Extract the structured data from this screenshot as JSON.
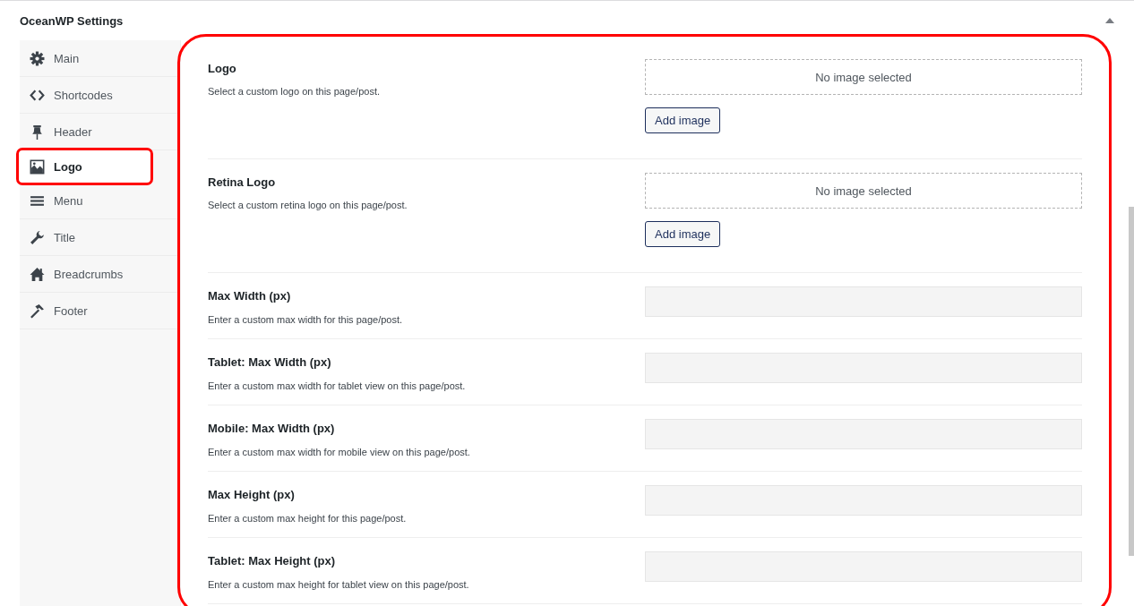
{
  "panel": {
    "title": "OceanWP Settings",
    "expanded": true
  },
  "sidebar": {
    "items": [
      {
        "label": "Main",
        "selected": false
      },
      {
        "label": "Shortcodes",
        "selected": false
      },
      {
        "label": "Header",
        "selected": false
      },
      {
        "label": "Logo",
        "selected": true
      },
      {
        "label": "Menu",
        "selected": false
      },
      {
        "label": "Title",
        "selected": false
      },
      {
        "label": "Breadcrumbs",
        "selected": false
      },
      {
        "label": "Footer",
        "selected": false
      }
    ]
  },
  "settings": [
    {
      "kind": "image",
      "label": "Logo",
      "description": "Select a custom logo on this page/post.",
      "preview": "No image selected",
      "button": "Add image"
    },
    {
      "kind": "image",
      "label": "Retina Logo",
      "description": "Select a custom retina logo on this page/post.",
      "preview": "No image selected",
      "button": "Add image"
    },
    {
      "kind": "number",
      "label": "Max Width (px)",
      "description": "Enter a custom max width for this page/post."
    },
    {
      "kind": "number",
      "label": "Tablet: Max Width (px)",
      "description": "Enter a custom max width for tablet view on this page/post."
    },
    {
      "kind": "number",
      "label": "Mobile: Max Width (px)",
      "description": "Enter a custom max width for mobile view on this page/post."
    },
    {
      "kind": "number",
      "label": "Max Height (px)",
      "description": "Enter a custom max height for this page/post."
    },
    {
      "kind": "number",
      "label": "Tablet: Max Height (px)",
      "description": "Enter a custom max height for tablet view on this page/post."
    }
  ]
}
